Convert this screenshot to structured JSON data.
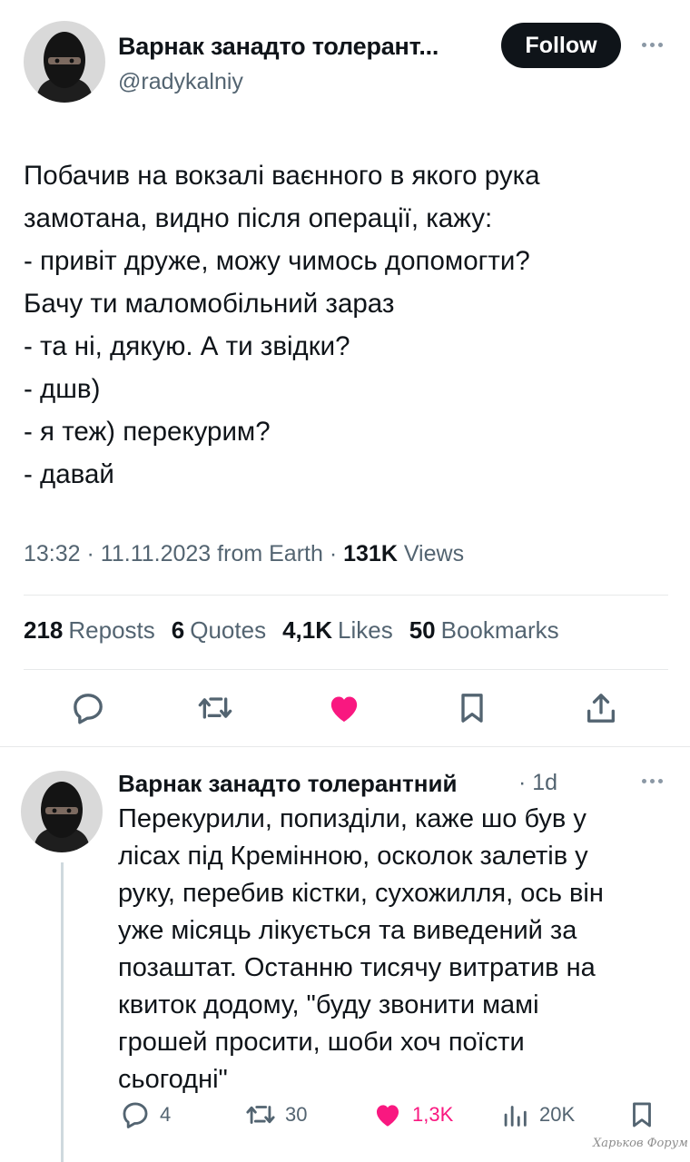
{
  "tweet": {
    "author_name": "Варнак занадто толерант...",
    "handle": "@radykalniy",
    "follow_label": "Follow",
    "lines": [
      "Побачив на вокзалі ваєнного в якого рука",
      "замотана, видно після операції, кажу:",
      "- привіт друже, можу чимось допомогти?",
      "Бачу ти маломобільний зараз",
      "- та ні, дякую. А ти звідки?",
      "- дшв)",
      "- я теж) перекурим?",
      "- давай"
    ],
    "time": "13:32",
    "date": "11.11.2023",
    "source": "from Earth",
    "views_count": "131K",
    "views_label": "Views"
  },
  "stats": {
    "reposts_count": "218",
    "reposts_label": "Reposts",
    "quotes_count": "6",
    "quotes_label": "Quotes",
    "likes_count": "4,1K",
    "likes_label": "Likes",
    "bookmarks_count": "50",
    "bookmarks_label": "Bookmarks"
  },
  "actions": [
    "reply-icon",
    "repost-icon",
    "like-icon",
    "bookmark-icon",
    "share-icon"
  ],
  "reply": {
    "author_name": "Варнак занадто толерантний",
    "time": "· 1d",
    "lines": [
      "Перекурили, попизділи, каже шо був у",
      "лісах під Кремінною, осколок залетів у",
      "руку, перебив кістки, сухожилля, ось він",
      "уже місяць лікується та виведений за",
      "позаштат. Останню тисячу витратив на",
      "квиток додому, \"буду звонити мамі",
      "грошей просити, шоби хоч поїсти",
      "сьогодні\""
    ],
    "replies": "4",
    "reposts": "30",
    "likes": "1,3K",
    "views": "20K"
  },
  "watermark": "Харьков Форум",
  "colors": {
    "text": "#0f1419",
    "secondary": "#536471",
    "like": "#f91880",
    "divider": "#e7e9ea",
    "follow_bg": "#0f1419"
  }
}
